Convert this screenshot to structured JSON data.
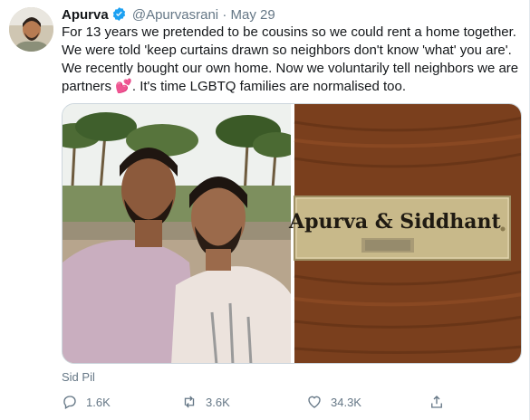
{
  "author": {
    "name": "Apurva",
    "handle": "@Apurvasrani",
    "separator": "·",
    "date": "May 29"
  },
  "tweet": {
    "text_part1": "For 13 years we pretended to be cousins so we could rent a home together. We were told 'keep curtains drawn so neighbors don't know 'what' you are'. We recently bought our own home. Now we voluntarily tell neighbors we are partners ",
    "emoji": "💕",
    "text_part2": ". It's time LGBTQ families are normalised too."
  },
  "media": {
    "nameplate_text": "Apurva & Siddhant"
  },
  "photo_credit": "Sid Pil",
  "actions": {
    "reply_count": "1.6K",
    "retweet_count": "3.6K",
    "like_count": "34.3K"
  },
  "colors": {
    "verified": "#1da1f2",
    "secondary_text": "#657786",
    "heart_emoji": "#e0245e",
    "wood": "#7a3f1d",
    "nameplate": "#c8b98a"
  },
  "icons": [
    "verified-badge-icon",
    "reply-icon",
    "retweet-icon",
    "like-icon",
    "share-icon"
  ]
}
